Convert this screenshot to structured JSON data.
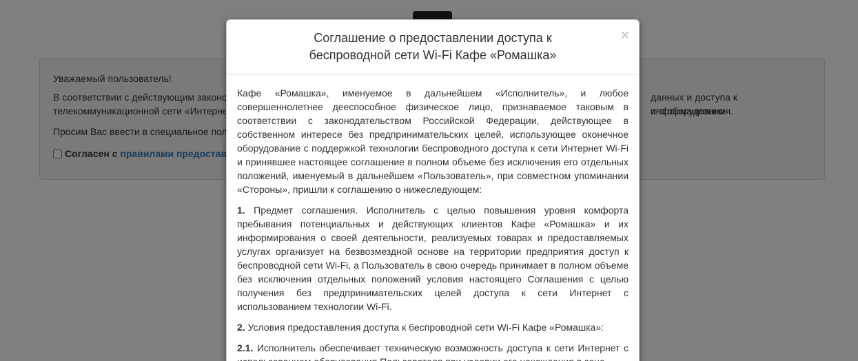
{
  "background": {
    "notice": {
      "greeting": "Уважаемый пользователь!",
      "paragraph1_left": "В соответствии с действующим законо",
      "paragraph1_right": "данных и доступа к информационно-",
      "paragraph1_line2_left": "телекоммуникационной сети «Интерне",
      "paragraph1_line2_right": "ого оборудования.",
      "paragraph2_left": "Просим Вас ввести в специальное поле",
      "consent_bold": "Согласен с",
      "consent_link": "правилами предоставл"
    }
  },
  "modal": {
    "title_line1": "Соглашение о предоставлении доступа к",
    "title_line2": "беспроводной сети Wi-Fi Кафе «Ромашка»",
    "close_label": "×",
    "body": {
      "intro": "Кафе «Ромашка», именуемое в дальнейшем «Исполнитель», и любое совершеннолетнее дееспособное физическое лицо, признаваемое таковым в соответствии с законодательством Российской Федерации, действующее в собственном интересе без предпринимательских целей, использующее оконечное оборудование с поддержкой технологии беспроводного доступа к сети Интернет Wi-Fi и принявшее настоящее соглашение в полном объеме без исключения его отдельных положений, именуемый в дальнейшем «Пользователь», при совместном упоминании «Стороны», пришли к соглашению о нижеследующем:",
      "s1_num": "1.",
      "s1_text": " Предмет соглашения. Исполнитель с целью повышения уровня комфорта пребывания потенциальных и действующих клиентов Кафе «Ромашка» и их информирования о своей деятельности, реализуемых товарах и предоставляемых услугах организует на безвозмездной основе на территории предприятия доступ к беспроводной сети Wi-Fi, а Пользователь в свою очередь принимает в полном объеме без исключения отдельных положений условия настоящего Соглашения с целью получения без предпринимательских целей доступа к сети Интернет с использованием технологии Wi-Fi.",
      "s2_num": "2.",
      "s2_text": " Условия предоставления доступа к беспроводной сети Wi-Fi Кафе «Ромашка»:",
      "s21_num": "2.1.",
      "s21_text": " Исполнитель обеспечивает техническую возможность доступа к сети Интернет с использованием оборудования Пользователя при условии его нахождения в зоне"
    }
  }
}
